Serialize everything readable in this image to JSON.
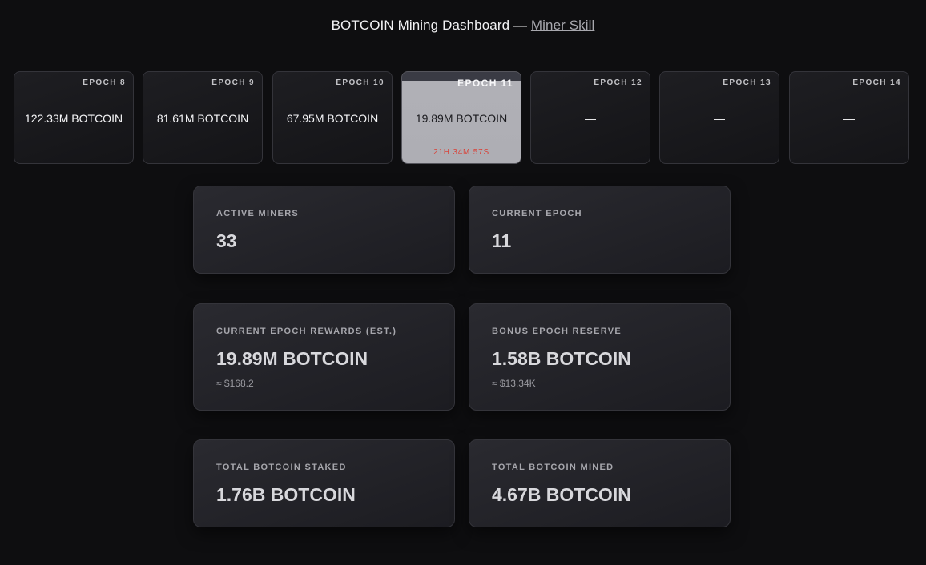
{
  "header": {
    "title": "BOTCOIN Mining Dashboard —",
    "link": "Miner Skill"
  },
  "epochs": [
    {
      "label": "EPOCH 8",
      "value": "122.33M BOTCOIN"
    },
    {
      "label": "EPOCH 9",
      "value": "81.61M BOTCOIN"
    },
    {
      "label": "EPOCH 10",
      "value": "67.95M BOTCOIN"
    },
    {
      "label": "EPOCH 11",
      "value": "19.89M BOTCOIN",
      "timer": "21H 34M 57S",
      "active": true
    },
    {
      "label": "EPOCH 12",
      "value": "—"
    },
    {
      "label": "EPOCH 13",
      "value": "—"
    },
    {
      "label": "EPOCH 14",
      "value": "—"
    }
  ],
  "stats": {
    "active_miners": {
      "label": "ACTIVE MINERS",
      "value": "33"
    },
    "current_epoch": {
      "label": "CURRENT EPOCH",
      "value": "11"
    },
    "epoch_rewards": {
      "label": "CURRENT EPOCH REWARDS (EST.)",
      "value": "19.89M BOTCOIN",
      "sub": "≈ $168.2"
    },
    "bonus_reserve": {
      "label": "BONUS EPOCH RESERVE",
      "value": "1.58B BOTCOIN",
      "sub": "≈ $13.34K"
    },
    "total_staked": {
      "label": "TOTAL BOTCOIN STAKED",
      "value": "1.76B BOTCOIN"
    },
    "total_mined": {
      "label": "TOTAL BOTCOIN MINED",
      "value": "4.67B BOTCOIN"
    }
  },
  "colors": {
    "background": "#0e0e10",
    "timer": "#d8433a",
    "active_epoch": "#b0b0b6"
  }
}
